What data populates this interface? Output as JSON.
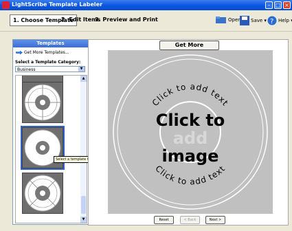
{
  "window": {
    "title": "LightScribe Template Labeler"
  },
  "steps": [
    {
      "label": "1. Choose Template",
      "active": true
    },
    {
      "label": "2. Edit Items",
      "active": false
    },
    {
      "label": "3. Preview and Print",
      "active": false
    }
  ],
  "toolbar": {
    "open_label": "Open",
    "save_label": "Save",
    "help_label": "Help"
  },
  "left_panel": {
    "header": "Templates",
    "get_more_link": "Get More Templates...",
    "category_label": "Select a Template Category:",
    "category_value": "Business",
    "tooltip": "Select a template for your label design"
  },
  "main": {
    "get_more_button": "Get More Templates...",
    "top_text": "Click to add text",
    "bottom_text": "Click to add text",
    "image_line1": "Click to",
    "image_line2": "add",
    "image_line3": "image",
    "buttons": {
      "reset": "Reset",
      "back": "< Back",
      "next": "Next >"
    }
  },
  "colors": {
    "accent": "#3163c5",
    "titlebar": "#0a55e0",
    "canvas": "#c0c0c0"
  }
}
